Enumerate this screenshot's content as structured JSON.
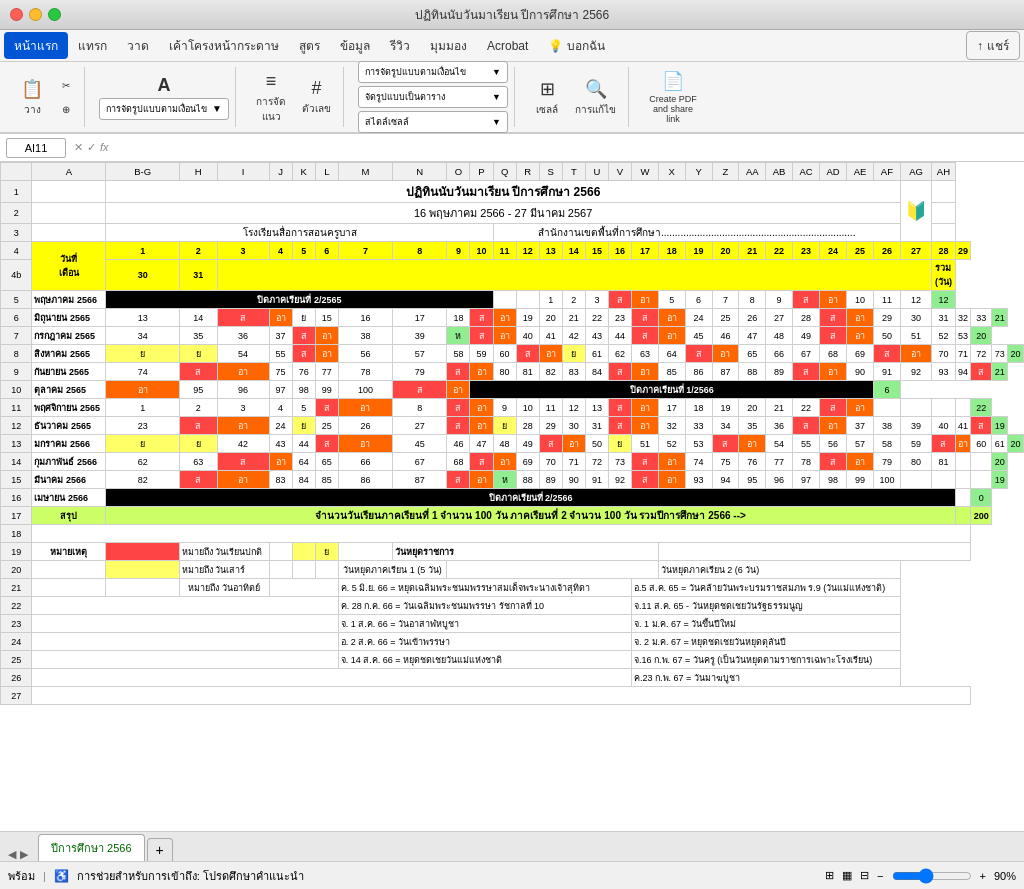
{
  "titleBar": {
    "title": "ปฏิทินนับวันมาเรียน ปีการศึกษา 2566"
  },
  "menuBar": {
    "items": [
      "หน้าแรก",
      "แทรก",
      "วาด",
      "เค้าโครงหน้ากระดาษ",
      "สูตร",
      "ข้อมูล",
      "รีวิว",
      "มุมมอง",
      "Acrobat",
      "บอกฉัน"
    ]
  },
  "toolbar": {
    "paste": "วาง",
    "font": "ฟอนต์",
    "align": "การจัด\nแนว",
    "number": "ตัวเลข",
    "format_dropdown": "การจัดรูปแบบตามเงื่อนไข",
    "table_format": "จัดรูปแบบเป็นตาราง",
    "cell_style": "สไตล์เซลล์",
    "cells": "เซลล์",
    "edit": "การแก้ไข",
    "createpdf": "Create PDF\nand share link",
    "share": "แชร์"
  },
  "formulaBar": {
    "cellRef": "AI11",
    "formula": ""
  },
  "spreadsheet": {
    "title1": "ปฏิทินนับวันมาเรียน ปีการศึกษา 2566",
    "title2": "16 พฤษภาคม 2566 - 27 มีนาคม 2567",
    "school": "โรงเรียนสื่อการสอนครูบาส",
    "office": "สำนักงานเขตพื้นที่การศึกษา..............................",
    "months": [
      "พฤษภาคม 2566",
      "มิถุนายน 2565",
      "กรกฎาคม 2565",
      "สิงหาคม 2565",
      "กันยายน 2565",
      "ตุลาคม 2565",
      "พฤศจิกายน 2565",
      "ธันวาคม 2565",
      "มกราคม 2566",
      "กุมภาพันธ์ 2566",
      "มีนาคม 2566",
      "เมษายน 2566"
    ],
    "summary_row": "สรุป",
    "note_row": "หมายเหตุ",
    "total_col": "รวม\n(วัน)"
  },
  "tabBar": {
    "sheets": [
      "ปีการศึกษา 2566"
    ],
    "addLabel": "+"
  },
  "statusBar": {
    "ready": "พร้อม",
    "accessibility": "การช่วยสำหรับการเข้าถึง: โปรดศึกษาคำแนะนำ",
    "zoom": "90%"
  },
  "colors": {
    "accent": "#0055d4",
    "sat": "#ff4444",
    "sun": "#ff6600",
    "holiday": "#90ee90",
    "semester_break": "#000000",
    "header_yellow": "#ffff00",
    "sum_green": "#90ee90"
  }
}
